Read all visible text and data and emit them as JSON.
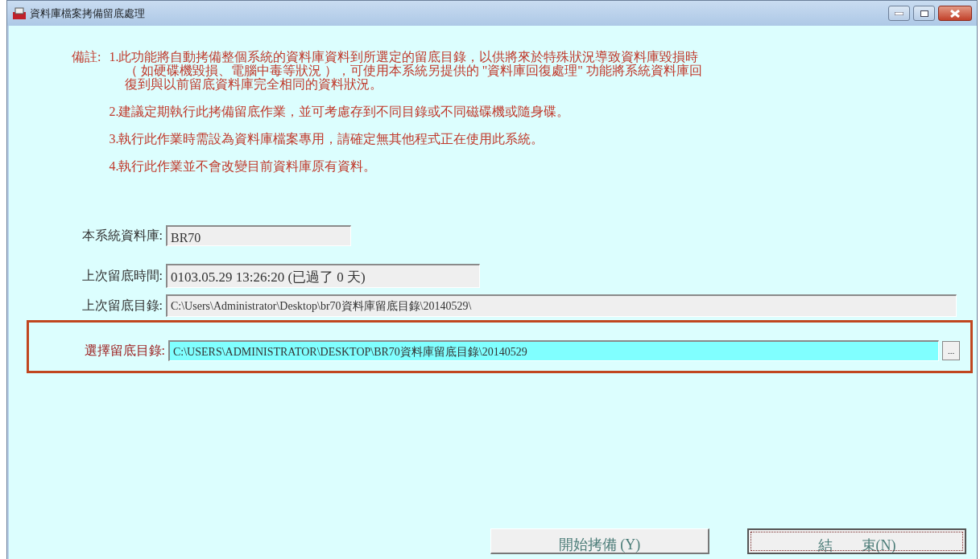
{
  "window": {
    "title": "資料庫檔案拷備留底處理"
  },
  "notes": {
    "label": "備註:",
    "items": [
      {
        "lines": [
          "1.此功能將自動拷備整個系統的資料庫資料到所選定的留底目錄，以供將來於特殊狀況導致資料庫毀損時",
          "（ 如硬碟機毀損、電腦中毒等狀況 ），可使用本系統另提供的 \"資料庫回復處理\" 功能將系統資料庫回",
          "復到與以前留底資料庫完全相同的資料狀況。"
        ]
      },
      {
        "lines": [
          "2.建議定期執行此拷備留底作業，並可考慮存到不同目錄或不同磁碟機或隨身碟。"
        ]
      },
      {
        "lines": [
          "3.執行此作業時需設為資料庫檔案專用，請確定無其他程式正在使用此系統。"
        ]
      },
      {
        "lines": [
          "4.執行此作業並不會改變目前資料庫原有資料。"
        ]
      }
    ]
  },
  "fields": [
    {
      "label": "本系統資料庫:",
      "value": "BR70",
      "kind": "short"
    },
    {
      "label": "上次留底時間:",
      "value": "0103.05.29 13:26:20 (已過了 0 天)",
      "kind": "medium"
    },
    {
      "label": "上次留底目錄:",
      "value": "C:\\Users\\Administrator\\Desktop\\br70資料庫留底目錄\\20140529\\",
      "kind": "long"
    },
    {
      "label": "選擇留底目錄:",
      "value": "C:\\USERS\\ADMINISTRATOR\\DESKTOP\\BR70資料庫留底目錄\\20140529",
      "kind": "select",
      "browse": "..."
    }
  ],
  "buttons": [
    {
      "label": "開始拷備 (Y)",
      "focused": false
    },
    {
      "label": "結　　束(N)",
      "focused": true
    }
  ]
}
